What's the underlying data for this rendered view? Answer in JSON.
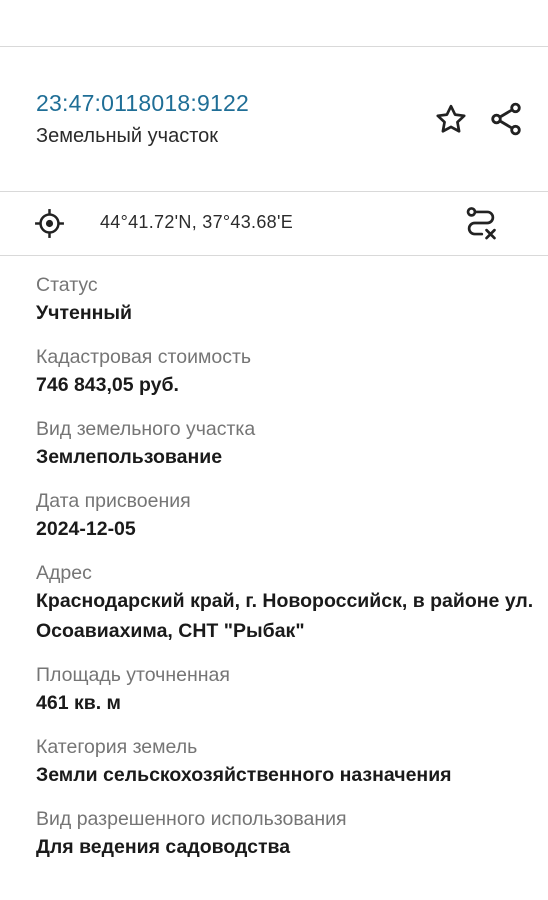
{
  "card": {
    "cadastral_number": "23:47:0118018:9122",
    "object_type": "Земельный участок",
    "favorite_icon": "star-icon",
    "share_icon": "share-icon"
  },
  "location": {
    "locate_icon": "crosshair-icon",
    "coordinates": "44°41.72'N, 37°43.68'E",
    "route_icon": "route-off-icon"
  },
  "properties": [
    {
      "label": "Статус",
      "value": "Учтенный"
    },
    {
      "label": "Кадастровая стоимость",
      "value": "746 843,05 руб."
    },
    {
      "label": "Вид земельного участка",
      "value": "Землепользование"
    },
    {
      "label": "Дата присвоения",
      "value": "2024-12-05"
    },
    {
      "label": "Адрес",
      "value": "Краснодарский край, г. Новороссийск, в районе ул. Осоавиахима, СНТ \"Рыбак\""
    },
    {
      "label": "Площадь уточненная",
      "value": "461 кв. м"
    },
    {
      "label": "Категория земель",
      "value": "Земли сельскохозяйственного назначения"
    },
    {
      "label": "Вид разрешенного использования",
      "value": "Для ведения садоводства"
    }
  ]
}
